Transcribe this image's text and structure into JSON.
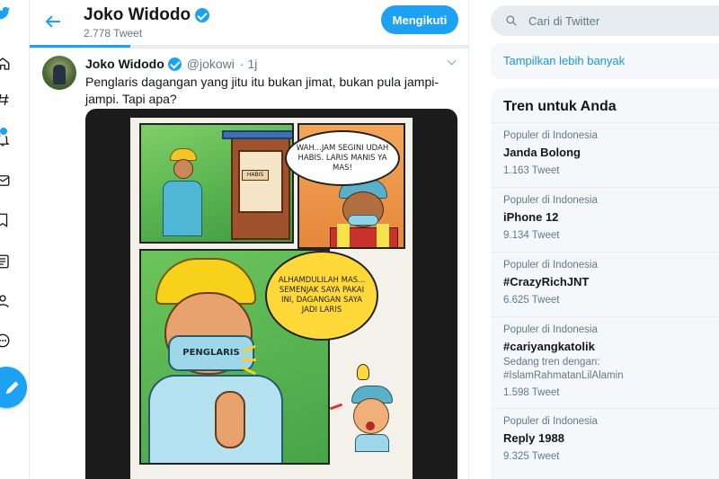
{
  "header": {
    "name": "Joko Widodo",
    "tweet_count": "2.778 Tweet",
    "follow_label": "Mengikuti"
  },
  "tweet": {
    "author_name": "Joko Widodo",
    "handle": "@jokowi",
    "time": "· 1j",
    "text": "Penglaris dagangan yang jitu itu bukan jimat, bukan pula jampi-jampi. Tapi apa?",
    "comic": {
      "sign_text": "HABIS",
      "bubble1": "WAH...JAM SEGINI UDAH HABIS. LARIS MANIS YA MAS!",
      "bubble2": "ALHAMDULILAH MAS... SEMENJAK SAYA PAKAI INI, DAGANGAN SAYA JADI LARIS",
      "mask_text": "PENGLARIS"
    }
  },
  "search": {
    "placeholder": "Cari di Twitter"
  },
  "sidebar": {
    "show_more": "Tampilkan lebih banyak",
    "trends_title": "Tren untuk Anda",
    "trends": [
      {
        "category": "Populer di Indonesia",
        "name": "Janda Bolong",
        "count": "1.163 Tweet"
      },
      {
        "category": "Populer di Indonesia",
        "name": "iPhone 12",
        "count": "9.134 Tweet"
      },
      {
        "category": "Populer di Indonesia",
        "name": "#CrazyRichJNT",
        "count": "6.625 Tweet"
      },
      {
        "category": "Populer di Indonesia",
        "name": "#cariyangkatolik",
        "sub1": "Sedang tren dengan:",
        "sub2": "#IslamRahmatanLilAlamin",
        "count": "1.598 Tweet"
      },
      {
        "category": "Populer di Indonesia",
        "name": "Reply 1988",
        "count": "9.325 Tweet"
      }
    ]
  },
  "colors": {
    "accent": "#1da1f2",
    "link": "#1b95e0",
    "secondary_text": "#657786",
    "panel_bg": "#f5f8fa"
  },
  "icons": [
    "bird-icon",
    "home-icon",
    "explore-icon",
    "notifications-icon",
    "messages-icon",
    "bookmarks-icon",
    "lists-icon",
    "profile-icon",
    "more-icon",
    "compose-icon",
    "back-arrow-icon",
    "verified-icon",
    "chevron-down-icon",
    "search-icon"
  ]
}
